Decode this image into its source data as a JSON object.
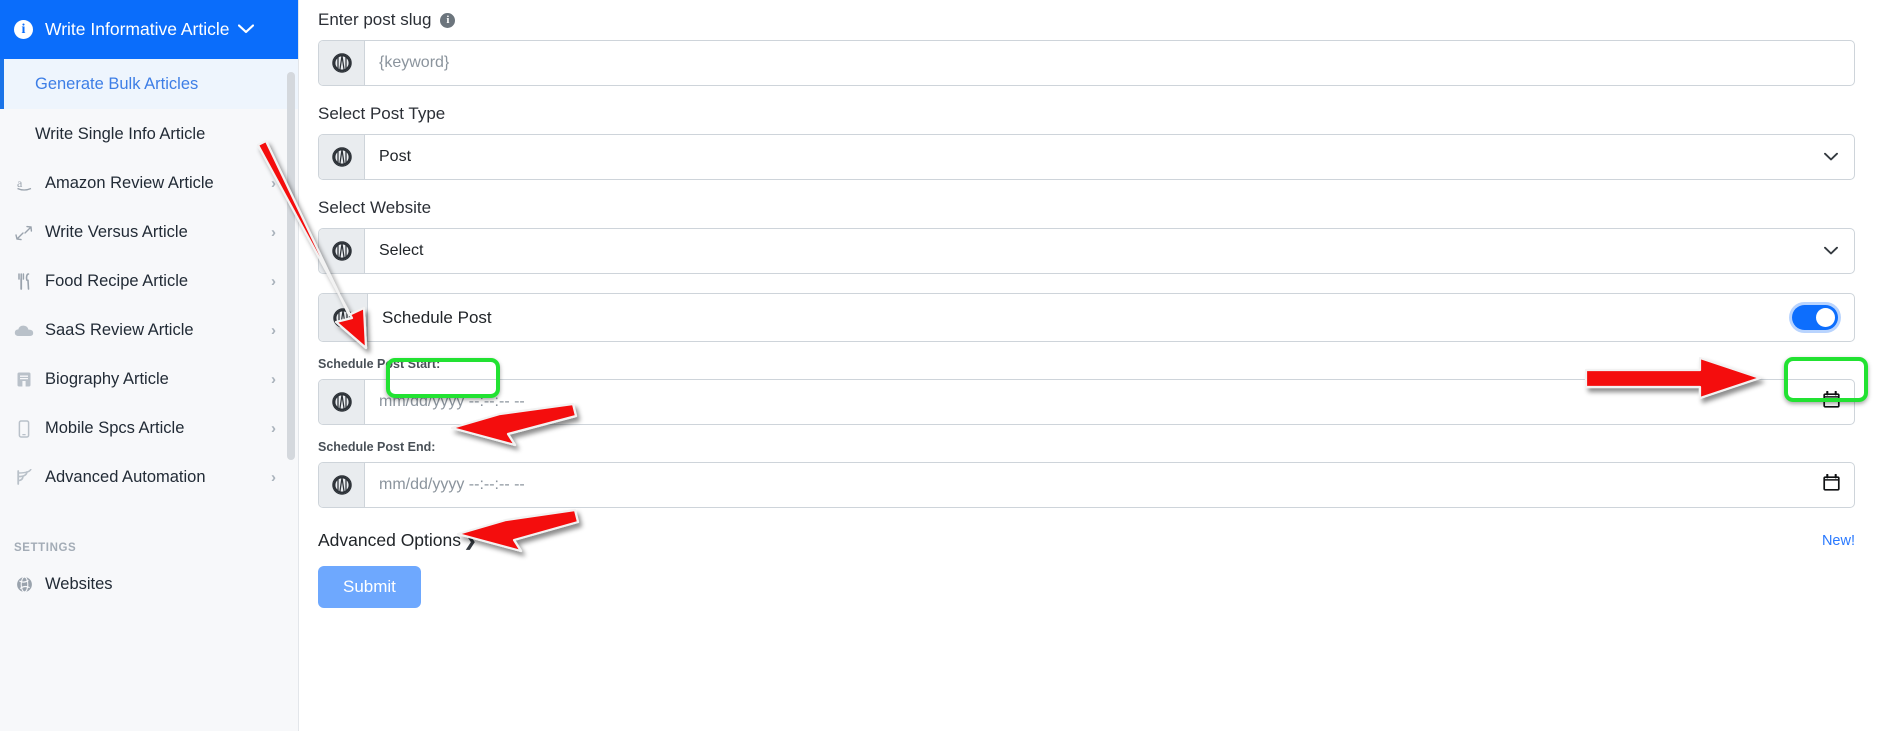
{
  "sidebar": {
    "header": {
      "title": "Write Informative Article",
      "info_icon": "info-icon",
      "chevron": "⌄"
    },
    "sub_items": [
      {
        "label": "Generate Bulk Articles",
        "active": true
      },
      {
        "label": "Write Single Info Article",
        "active": false
      }
    ],
    "items": [
      {
        "label": "Amazon Review Article",
        "icon": "amazon-icon",
        "chevron": "›"
      },
      {
        "label": "Write Versus Article",
        "icon": "versus-arrows-icon",
        "chevron": "›"
      },
      {
        "label": "Food Recipe Article",
        "icon": "cutlery-icon",
        "chevron": "›"
      },
      {
        "label": "SaaS Review Article",
        "icon": "cloud-icon",
        "chevron": "›"
      },
      {
        "label": "Biography Article",
        "icon": "book-icon",
        "chevron": "›"
      },
      {
        "label": "Mobile Spcs Article",
        "icon": "mobile-icon",
        "chevron": "›"
      },
      {
        "label": "Advanced Automation",
        "icon": "broadcast-icon",
        "chevron": "›"
      }
    ],
    "settings_section": "SETTINGS",
    "settings_items": [
      {
        "label": "Websites",
        "icon": "globe-icon"
      }
    ]
  },
  "form": {
    "slug": {
      "label": "Enter post slug",
      "info_icon": "info-icon",
      "placeholder": "{keyword}",
      "addon_icon": "wordpress-icon"
    },
    "post_type": {
      "label": "Select Post Type",
      "value": "Post",
      "addon_icon": "wordpress-icon",
      "chevron": "⌄"
    },
    "website": {
      "label": "Select Website",
      "value": "Select",
      "addon_icon": "wordpress-icon",
      "chevron": "⌄"
    },
    "schedule_post": {
      "label": "Schedule Post",
      "addon_icon": "wordpress-icon",
      "toggle_on": true
    },
    "schedule_start": {
      "label": "Schedule Post Start:",
      "placeholder": "mm/dd/yyyy --:--:-- --",
      "addon_icon": "wordpress-icon",
      "picker_icon": "calendar-icon"
    },
    "schedule_end": {
      "label": "Schedule Post End:",
      "placeholder": "mm/dd/yyyy --:--:-- --",
      "addon_icon": "wordpress-icon",
      "picker_icon": "calendar-icon"
    },
    "advanced_options": {
      "label": "Advanced Options",
      "chevron": "❯"
    },
    "new_badge": "New!",
    "submit": "Submit"
  },
  "annotations": {
    "accent_green": "#22e232",
    "accent_red": "#f40d0d",
    "arrow_count": 4,
    "highlight_count": 2
  }
}
